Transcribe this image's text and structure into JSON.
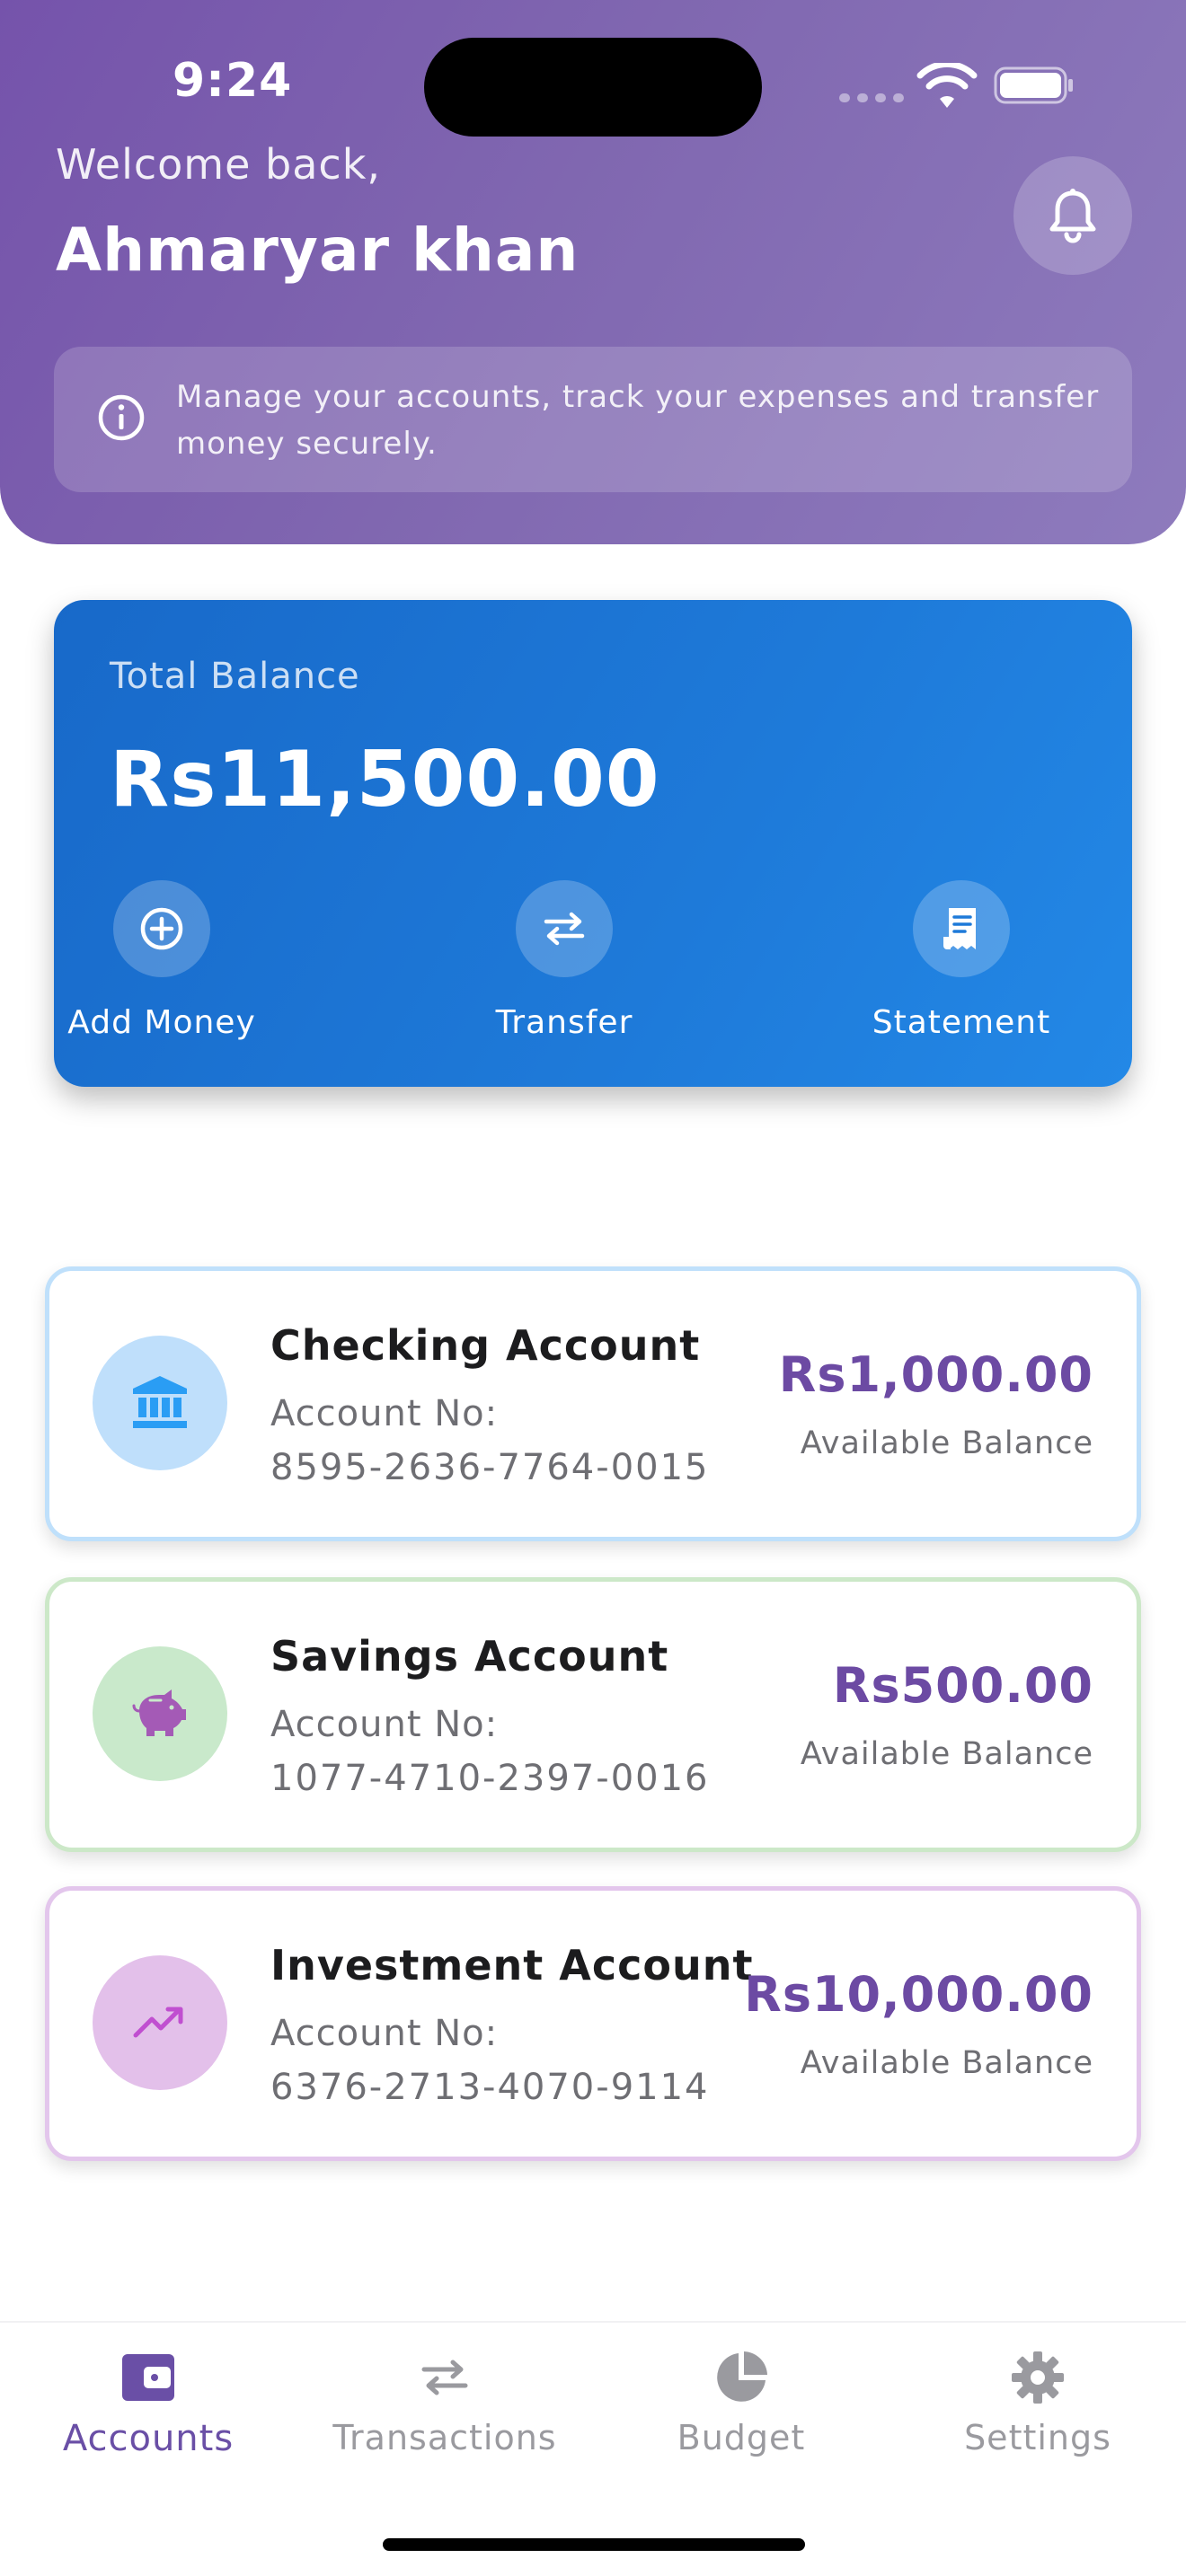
{
  "status_bar": {
    "time": "9:24"
  },
  "header": {
    "welcome": "Welcome back,",
    "user_name": "Ahmaryar khan",
    "info_text": "Manage your accounts, track your expenses and transfer money securely."
  },
  "balance": {
    "label": "Total Balance",
    "value": "Rs11,500.00",
    "actions": [
      {
        "label": "Add Money",
        "icon": "add-circle-icon"
      },
      {
        "label": "Transfer",
        "icon": "swap-icon"
      },
      {
        "label": "Statement",
        "icon": "receipt-icon"
      }
    ]
  },
  "accounts": [
    {
      "name": "Checking Account",
      "number_label": "Account No:",
      "number": "8595-2636-7764-0015",
      "amount": "Rs1,000.00",
      "amount_label": "Available Balance",
      "icon": "bank-icon",
      "color": "#2a9df4"
    },
    {
      "name": "Savings Account",
      "number_label": "Account No:",
      "number": "1077-4710-2397-0016",
      "amount": "Rs500.00",
      "amount_label": "Available Balance",
      "icon": "piggy-bank-icon",
      "color": "#a45ab6"
    },
    {
      "name": "Investment Account",
      "number_label": "Account No:",
      "number": "6376-2713-4070-9114",
      "amount": "Rs10,000.00",
      "amount_label": "Available Balance",
      "icon": "trending-up-icon",
      "color": "#c04fd0"
    }
  ],
  "nav": [
    {
      "label": "Accounts",
      "icon": "wallet-icon",
      "active": true
    },
    {
      "label": "Transactions",
      "icon": "swap-icon",
      "active": false
    },
    {
      "label": "Budget",
      "icon": "pie-chart-icon",
      "active": false
    },
    {
      "label": "Settings",
      "icon": "gear-icon",
      "active": false
    }
  ],
  "colors": {
    "header": "#7553ab",
    "card": "#1e7ad9",
    "accent": "#6c4aa3"
  }
}
